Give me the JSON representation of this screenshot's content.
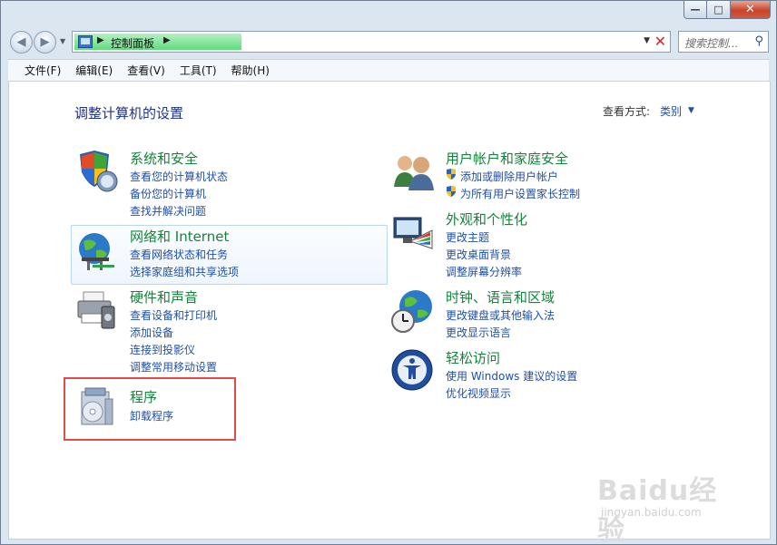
{
  "window": {
    "caption_buttons": {
      "minimize": "—",
      "maximize": "□",
      "close": "✕"
    }
  },
  "address_bar": {
    "crumb": "控制面板",
    "search_placeholder": "搜索控制...",
    "separator": "▶",
    "dropdown": "▼",
    "stop": "✕"
  },
  "menu": [
    "文件(F)",
    "编辑(E)",
    "查看(V)",
    "工具(T)",
    "帮助(H)"
  ],
  "page": {
    "title": "调整计算机的设置",
    "view_label": "查看方式:",
    "view_value": "类别"
  },
  "categories": [
    {
      "title": "系统和安全",
      "links": [
        "查看您的计算机状态",
        "备份您的计算机",
        "查找并解决问题"
      ]
    },
    {
      "title": "网络和 Internet",
      "links": [
        "查看网络状态和任务",
        "选择家庭组和共享选项"
      ]
    },
    {
      "title": "硬件和声音",
      "links": [
        "查看设备和打印机",
        "添加设备",
        "连接到投影仪",
        "调整常用移动设置"
      ]
    },
    {
      "title": "程序",
      "links": [
        "卸载程序"
      ]
    },
    {
      "title": "用户帐户和家庭安全",
      "links": [
        "添加或删除用户帐户",
        "为所有用户设置家长控制"
      ]
    },
    {
      "title": "外观和个性化",
      "links": [
        "更改主题",
        "更改桌面背景",
        "调整屏幕分辨率"
      ]
    },
    {
      "title": "时钟、语言和区域",
      "links": [
        "更改键盘或其他输入法",
        "更改显示语言"
      ]
    },
    {
      "title": "轻松访问",
      "links": [
        "使用 Windows 建议的设置",
        "优化视频显示"
      ]
    }
  ],
  "watermark": {
    "brand": "Baidu经验",
    "url": "jingyan.baidu.com"
  },
  "colors": {
    "category_title": "#14833b",
    "link": "#1f4fa8",
    "title": "#1e3287",
    "highlight": "#e34a4a"
  },
  "icons": {
    "system_security": "shield-computer-icon",
    "network": "globe-network-icon",
    "hardware": "printer-icon",
    "programs": "program-box-icon",
    "user_accounts": "users-icon",
    "appearance": "monitor-palette-icon",
    "clock_region": "globe-clock-icon",
    "ease_access": "ease-of-access-icon"
  }
}
